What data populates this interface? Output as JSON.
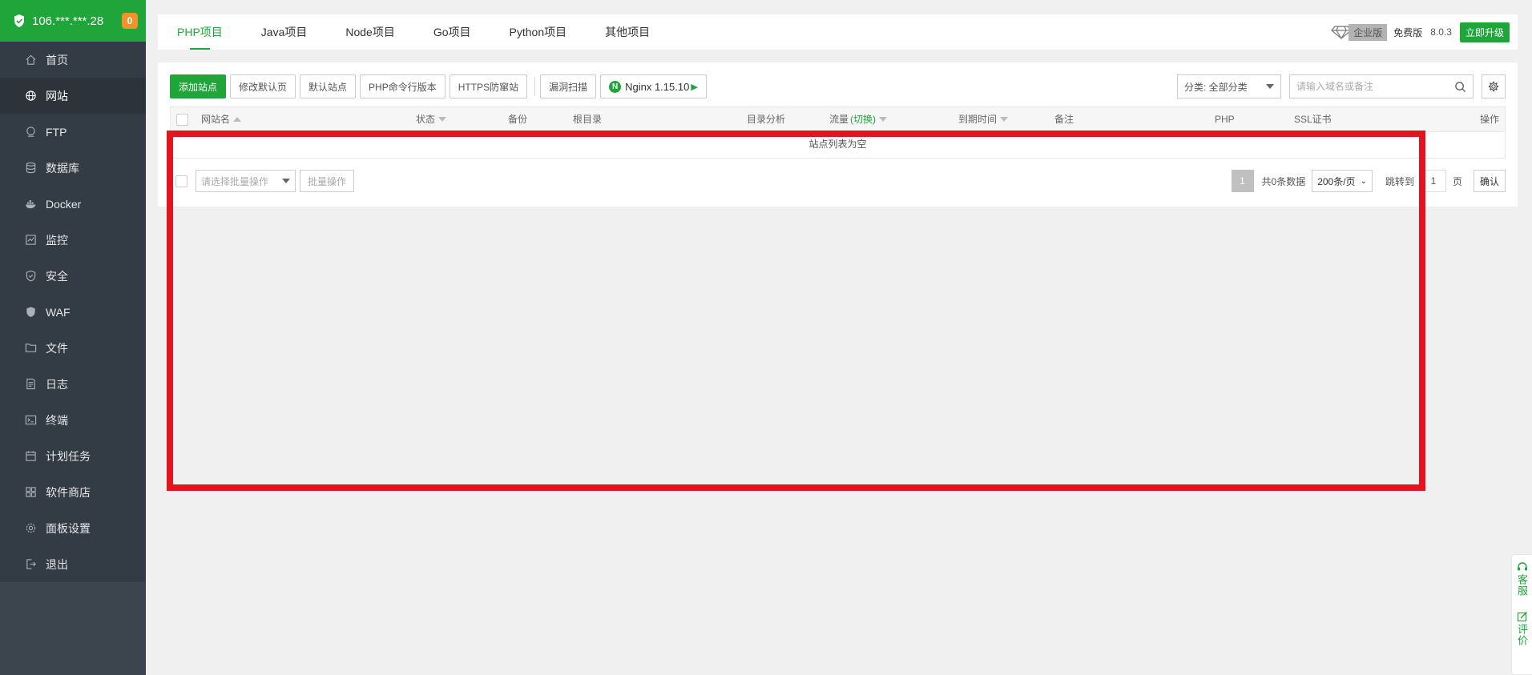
{
  "sidebar": {
    "ip": "106.***.***.28",
    "badge": "0",
    "items": [
      {
        "label": "首页",
        "icon": "home-icon"
      },
      {
        "label": "网站",
        "icon": "globe-icon"
      },
      {
        "label": "FTP",
        "icon": "ftp-icon"
      },
      {
        "label": "数据库",
        "icon": "database-icon"
      },
      {
        "label": "Docker",
        "icon": "docker-icon"
      },
      {
        "label": "监控",
        "icon": "monitor-icon"
      },
      {
        "label": "安全",
        "icon": "shield-icon"
      },
      {
        "label": "WAF",
        "icon": "waf-icon"
      },
      {
        "label": "文件",
        "icon": "folder-icon"
      },
      {
        "label": "日志",
        "icon": "log-icon"
      },
      {
        "label": "终端",
        "icon": "terminal-icon"
      },
      {
        "label": "计划任务",
        "icon": "calendar-icon"
      },
      {
        "label": "软件商店",
        "icon": "apps-icon"
      },
      {
        "label": "面板设置",
        "icon": "gear-icon"
      },
      {
        "label": "退出",
        "icon": "logout-icon"
      }
    ],
    "active_index": 1
  },
  "tabs": [
    "PHP项目",
    "Java项目",
    "Node项目",
    "Go项目",
    "Python项目",
    "其他项目"
  ],
  "header_right": {
    "enterprise": "企业版",
    "free": "免费版",
    "version": "8.0.3",
    "upgrade": "立即升级"
  },
  "toolbar": {
    "add_site": "添加站点",
    "modify_default": "修改默认页",
    "default_site": "默认站点",
    "php_cli": "PHP命令行版本",
    "https_protect": "HTTPS防窜站",
    "vuln_scan": "漏洞扫描",
    "nginx": "Nginx 1.15.10",
    "category": "分类: 全部分类",
    "search_placeholder": "请输入域名或备注"
  },
  "table": {
    "headers": {
      "name": "网站名",
      "status": "状态",
      "backup": "备份",
      "root": "根目录",
      "dir_analysis": "目录分析",
      "traffic": "流量",
      "traffic_switch": "(切换)",
      "expire": "到期时间",
      "remark": "备注",
      "php": "PHP",
      "ssl": "SSL证书",
      "actions": "操作"
    },
    "empty_text": "站点列表为空"
  },
  "footer": {
    "batch_placeholder": "请选择批量操作",
    "batch_button": "批量操作",
    "current_page": "1",
    "total": "共0条数据",
    "per_page": "200条/页",
    "jump_label": "跳转到",
    "jump_value": "1",
    "page_suffix": "页",
    "confirm": "确认"
  },
  "float_widget": {
    "service": "客服",
    "review": "评价"
  },
  "colors": {
    "brand_green": "#20a53a",
    "sidebar_bg": "#3c444d",
    "highlight_red": "#e3141e",
    "badge_orange": "#f0932b"
  }
}
